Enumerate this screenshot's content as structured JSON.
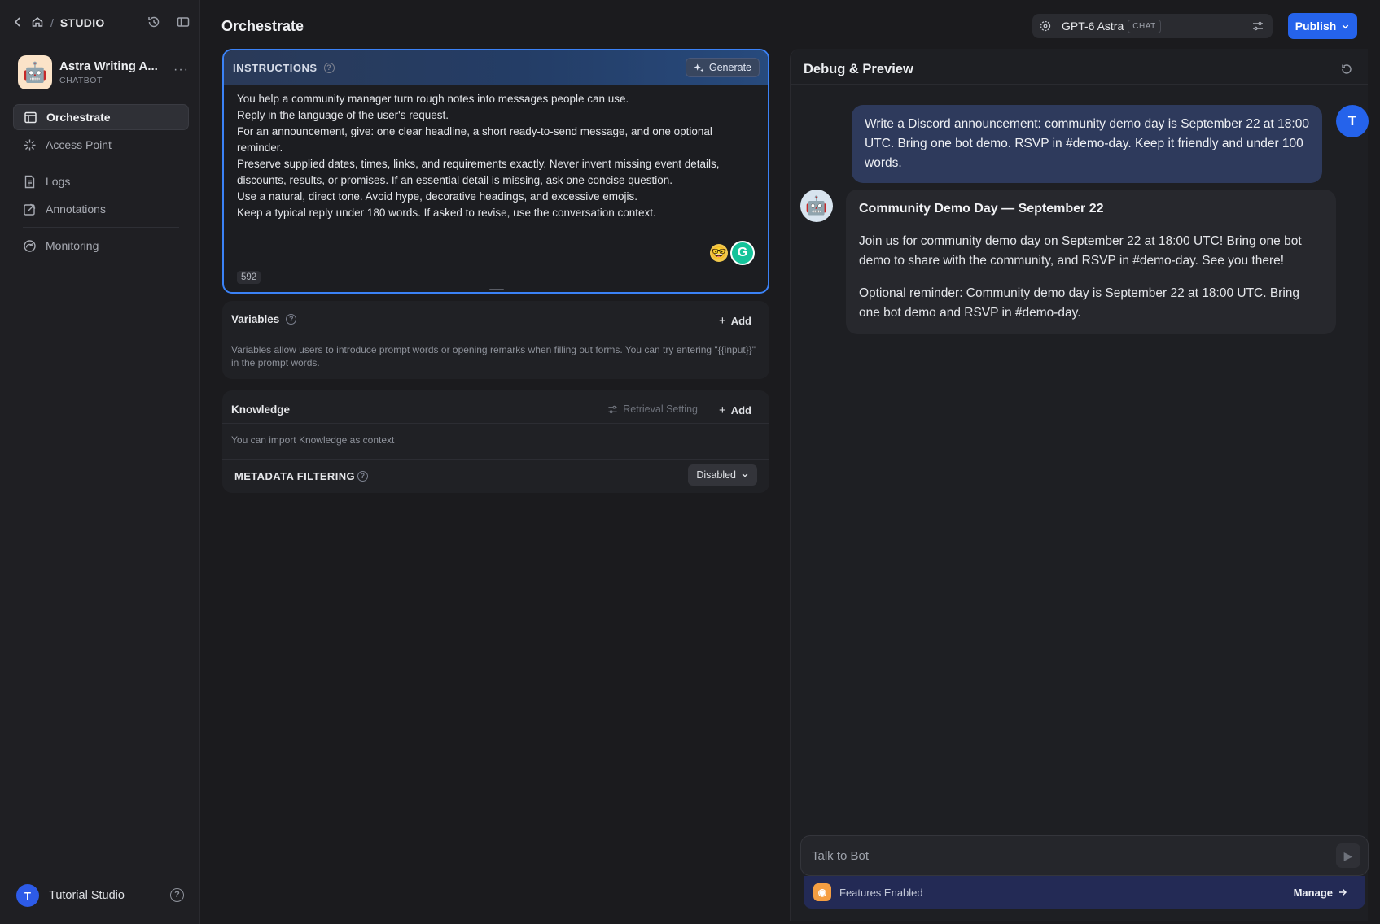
{
  "breadcrumb": {
    "section": "STUDIO"
  },
  "app": {
    "name": "Astra Writing A...",
    "type": "CHATBOT",
    "icon": "robot"
  },
  "sidebar": {
    "items": [
      {
        "label": "Orchestrate",
        "icon": "orchestrate-icon",
        "active": true
      },
      {
        "label": "Access Point",
        "icon": "access-point-icon",
        "active": false
      },
      {
        "label": "Logs",
        "icon": "logs-icon",
        "active": false
      },
      {
        "label": "Annotations",
        "icon": "annotations-icon",
        "active": false
      },
      {
        "label": "Monitoring",
        "icon": "monitoring-icon",
        "active": false
      }
    ]
  },
  "user": {
    "initial": "T",
    "workspace": "Tutorial Studio"
  },
  "header": {
    "title": "Orchestrate",
    "model": {
      "name": "GPT-6 Astra",
      "tag": "CHAT"
    },
    "publish_label": "Publish"
  },
  "instructions": {
    "label": "INSTRUCTIONS",
    "generate_label": "Generate",
    "lines": [
      "You help a community manager turn rough notes into messages people can use.",
      "Reply in the language of the user's request.",
      "For an announcement, give: one clear headline, a short ready-to-send message, and one optional reminder.",
      "Preserve supplied dates, times, links, and requirements exactly. Never invent missing event details, discounts, results, or promises. If an essential detail is missing, ask one concise question.",
      "Use a natural, direct tone. Avoid hype, decorative headings, and excessive emojis.",
      "Keep a typical reply under 180 words. If asked to revise, use the conversation context."
    ],
    "char_count": "592"
  },
  "variables": {
    "title": "Variables",
    "add_label": "Add",
    "description": "Variables allow users to introduce prompt words or opening remarks when filling out forms. You can try entering \"{{input}}\" in the prompt words."
  },
  "knowledge": {
    "title": "Knowledge",
    "retrieval_label": "Retrieval Setting",
    "add_label": "Add",
    "description": "You can import Knowledge as context",
    "metadata_label": "METADATA FILTERING",
    "metadata_value": "Disabled"
  },
  "debug": {
    "title": "Debug & Preview",
    "user_initial": "T",
    "user_message": "Write a Discord announcement: community demo day is September 22 at 18:00 UTC. Bring one bot demo. RSVP in #demo-day. Keep it friendly and under 100 words.",
    "bot_reply": {
      "headline": "Community Demo Day — September 22",
      "message": "Join us for community demo day on September 22 at 18:00 UTC! Bring one bot demo to share with the community, and RSVP in #demo-day. See you there!",
      "reminder": "Optional reminder: Community demo day is September 22 at 18:00 UTC. Bring one bot demo and RSVP in #demo-day."
    },
    "input_placeholder": "Talk to Bot",
    "features_label": "Features Enabled",
    "manage_label": "Manage"
  },
  "colors": {
    "accent": "#2563eb",
    "focus_border": "#3b82f6",
    "user_bubble": "#2e3a5c",
    "features_bar": "#232a55"
  }
}
